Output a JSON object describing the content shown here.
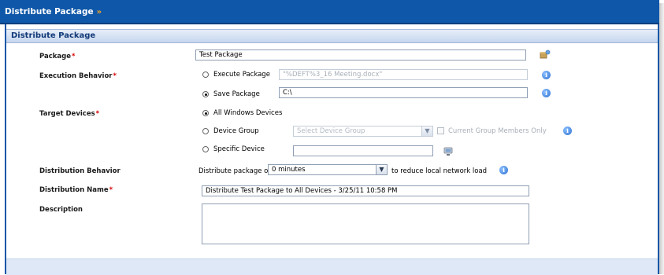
{
  "window": {
    "title": "Distribute Package",
    "title_arrow": "»"
  },
  "section": {
    "title": "Distribute Package"
  },
  "labels": {
    "package": "Package",
    "execution_behavior": "Execution Behavior",
    "target_devices": "Target Devices",
    "distribution_behavior": "Distribution Behavior",
    "distribution_name": "Distribution Name",
    "description": "Description",
    "required_mark": "*"
  },
  "package": {
    "value": "Test Package",
    "browse_icon": "package-browse-icon"
  },
  "execution": {
    "options": [
      {
        "label": "Execute Package",
        "selected": false
      },
      {
        "label": "Save Package",
        "selected": true
      }
    ],
    "execute_value": "\"%DEFT%3_16 Meeting.docx\"",
    "save_value": "C:\\"
  },
  "targets": {
    "options": [
      {
        "label": "All Windows Devices",
        "selected": true
      },
      {
        "label": "Device Group",
        "selected": false
      },
      {
        "label": "Specific Device",
        "selected": false
      }
    ],
    "group_placeholder": "Select Device Group",
    "current_members_label": "Current Group Members Only",
    "specific_value": ""
  },
  "distribution": {
    "prefix": "Distribute package over",
    "interval": "0 minutes",
    "suffix": "to reduce local network load",
    "name_value": "Distribute Test Package to All Devices - 3/25/11 10:58 PM",
    "description_value": ""
  },
  "colors": {
    "header_blue": "#0f57a8",
    "required_red": "#d40000",
    "info_blue": "#2c6fd1"
  }
}
